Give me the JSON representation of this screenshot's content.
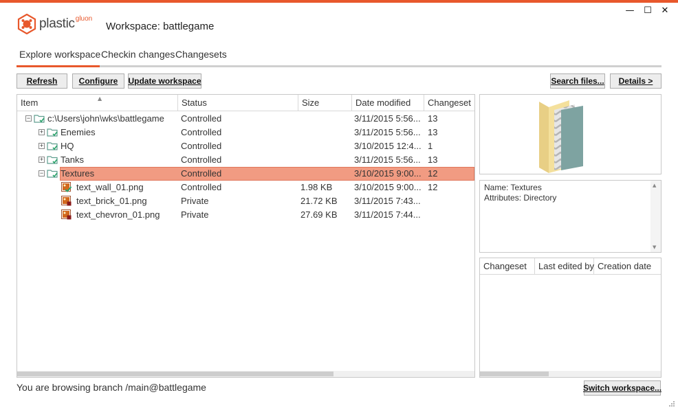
{
  "app": {
    "logo_text": "plastic",
    "logo_sup": "gluon",
    "workspace_title": "Workspace: battlegame",
    "accent_color": "#e8582c"
  },
  "window_controls": {
    "minimize": "—",
    "maximize": "☐",
    "close": "✕"
  },
  "tabs": [
    {
      "label": "Explore workspace",
      "active": true
    },
    {
      "label": "Checkin changes",
      "active": false
    },
    {
      "label": "Changesets",
      "active": false
    }
  ],
  "toolbar": {
    "refresh": "Refresh",
    "configure": "Configure",
    "update_workspace": "Update workspace",
    "search_files": "Search files...",
    "details": "Details >"
  },
  "tree": {
    "columns": [
      "Item",
      "Status",
      "Size",
      "Date modified",
      "Changeset"
    ],
    "rows": [
      {
        "name": "c:\\Users\\john\\wks\\battlegame",
        "status": "Controlled",
        "size": "",
        "date": "3/11/2015 5:56...",
        "changeset": "13",
        "type": "folder",
        "expander": "−"
      },
      {
        "name": "Enemies",
        "status": "Controlled",
        "size": "",
        "date": "3/11/2015 5:56...",
        "changeset": "13",
        "type": "folder",
        "expander": "+"
      },
      {
        "name": "HQ",
        "status": "Controlled",
        "size": "",
        "date": "3/10/2015 12:4...",
        "changeset": "1",
        "type": "folder",
        "expander": "+"
      },
      {
        "name": "Tanks",
        "status": "Controlled",
        "size": "",
        "date": "3/11/2015 5:56...",
        "changeset": "13",
        "type": "folder",
        "expander": "+"
      },
      {
        "name": "Textures",
        "status": "Controlled",
        "size": "",
        "date": "3/10/2015 9:00...",
        "changeset": "12",
        "type": "folder",
        "expander": "−",
        "selected": true
      },
      {
        "name": "text_wall_01.png",
        "status": "Controlled",
        "size": "1.98 KB",
        "date": "3/10/2015 9:00...",
        "changeset": "12",
        "type": "image-controlled"
      },
      {
        "name": "text_brick_01.png",
        "status": "Private",
        "size": "21.72 KB",
        "date": "3/11/2015 7:43...",
        "changeset": "",
        "type": "image-private"
      },
      {
        "name": "text_chevron_01.png",
        "status": "Private",
        "size": "27.69 KB",
        "date": "3/11/2015 7:44...",
        "changeset": "",
        "type": "image-private"
      }
    ]
  },
  "info": {
    "name_line": "Name: Textures",
    "attributes_line": "Attributes: Directory"
  },
  "history": {
    "columns": [
      "Changeset",
      "Last edited by",
      "Creation date"
    ]
  },
  "status_bar": {
    "text": "You are browsing branch /main@battlegame",
    "switch_workspace": "Switch workspace..."
  }
}
